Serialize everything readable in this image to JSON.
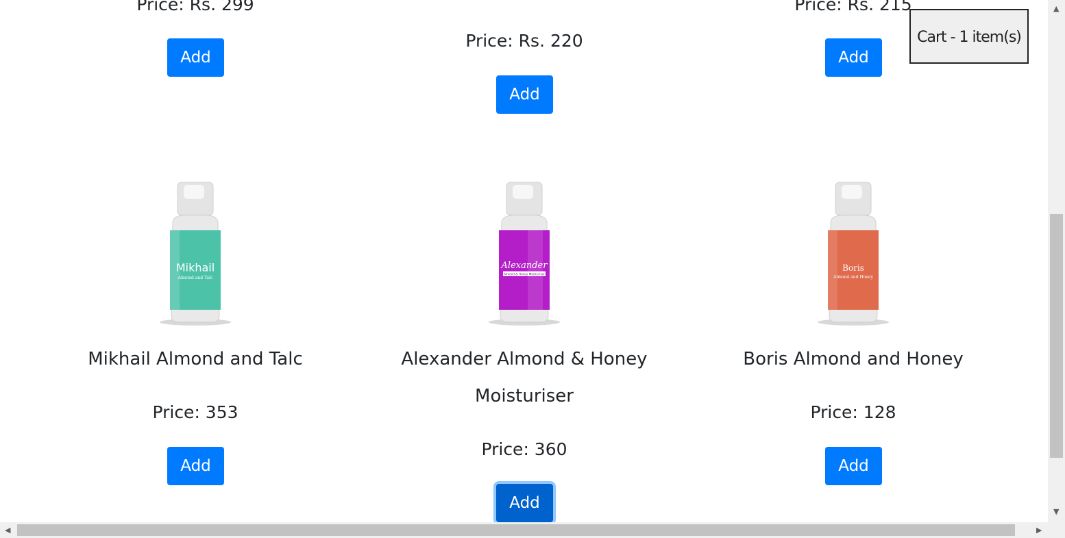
{
  "cart": {
    "label": "Cart - 1 item(s)"
  },
  "top_row": [
    {
      "price": "Price: Rs. 299",
      "add_label": "Add"
    },
    {
      "price": "Price: Rs. 220",
      "add_label": "Add"
    },
    {
      "price": "Price: Rs. 215",
      "add_label": "Add"
    }
  ],
  "products": [
    {
      "name": "Mikhail Almond and Talc",
      "price": "Price: 353",
      "add_label": "Add",
      "image": {
        "brand": "Mikhail",
        "subtitle": "Almond and Talc",
        "color": "#4cc3a8"
      }
    },
    {
      "name_line1": "Alexander Almond & Honey",
      "name_line2": "Moisturiser",
      "price": "Price: 360",
      "add_label": "Add",
      "image": {
        "brand": "Alexander",
        "subtitle": "Almond & Honey Moisturiser",
        "color": "#b41ec8"
      }
    },
    {
      "name": "Boris Almond and Honey",
      "price": "Price: 128",
      "add_label": "Add",
      "image": {
        "brand": "Boris",
        "subtitle": "Almond and Honey",
        "color": "#e06a4c"
      }
    }
  ],
  "colors": {
    "primary": "#007bff",
    "primary_active": "#0062cc"
  }
}
